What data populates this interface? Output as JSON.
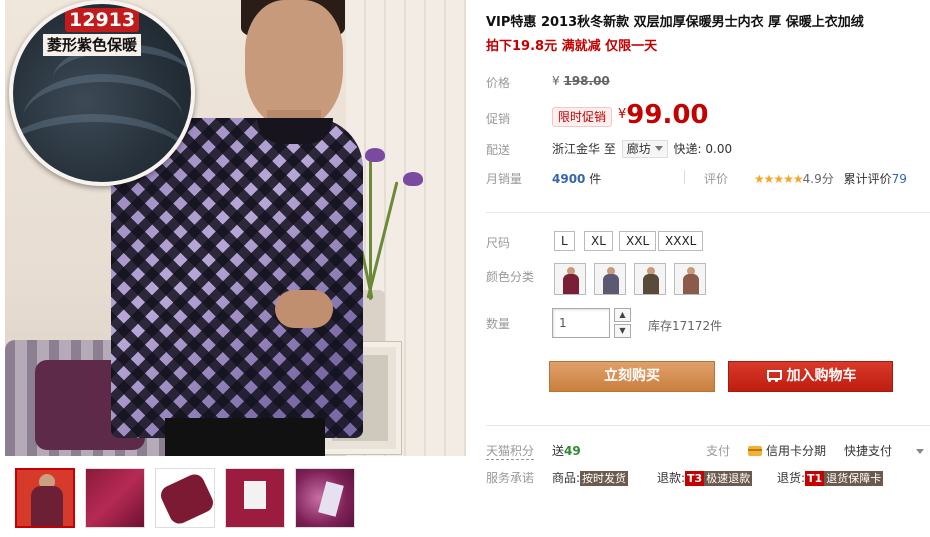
{
  "gallery": {
    "zoom_code": "12913",
    "zoom_title": "菱形紫色保暖"
  },
  "product": {
    "title": "VIP特惠 2013秋冬新款 双层加厚保暖男士内衣 厚 保暖上衣加绒",
    "promo": "拍下19.8元 满就减 仅限一天"
  },
  "price": {
    "label": "价格",
    "currency": "¥",
    "original": "198.00",
    "promo_label": "促销",
    "promo_tag": "限时促销",
    "current": "99.00"
  },
  "shipping": {
    "label": "配送",
    "from": "浙江金华",
    "to_word": "至",
    "to_city": "廊坊",
    "express": "快递: 0.00"
  },
  "sales": {
    "label": "月销量",
    "count": "4900",
    "unit": "件"
  },
  "rating": {
    "label": "评价",
    "stars": "★★★★★",
    "score": "4.9分",
    "total_label": "累计评价",
    "total_count": "79"
  },
  "size": {
    "label": "尺码",
    "options": [
      "L",
      "XL",
      "XXL",
      "XXXL"
    ]
  },
  "color": {
    "label": "颜色分类",
    "swatch_colors": [
      "#7a1f35",
      "#5b5a72",
      "#5a4a3a",
      "#8a5a4a"
    ]
  },
  "quantity": {
    "label": "数量",
    "value": "1",
    "stock": "库存17172件"
  },
  "actions": {
    "buy": "立刻购买",
    "cart": "加入购物车"
  },
  "points": {
    "label": "天猫积分",
    "prefix": "送",
    "value": "49"
  },
  "payment": {
    "label": "支付",
    "credit": "信用卡分期",
    "quick": "快捷支付"
  },
  "service": {
    "label": "服务承诺",
    "goods_label": "商品:",
    "goods_tag": "按时发货",
    "refund_label": "退款:",
    "refund_code": "T3",
    "refund_tag": "极速退款",
    "return_label": "退货:",
    "return_code": "T1",
    "return_tag": "退货保障卡"
  },
  "colors": {
    "accent_red": "#c40000",
    "buy_orange": "#c9803f",
    "cart_red": "#bf1d10",
    "link_blue": "#3366aa"
  }
}
